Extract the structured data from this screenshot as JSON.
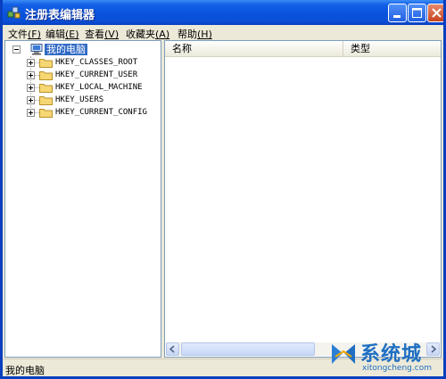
{
  "window": {
    "title": "注册表编辑器",
    "icon": "regedit-icon",
    "controls": [
      "minimize-icon",
      "maximize-icon",
      "close-icon"
    ]
  },
  "menu": [
    {
      "label": "文件",
      "accel": "(F)"
    },
    {
      "label": "编辑",
      "accel": "(E)"
    },
    {
      "label": "查看",
      "accel": "(V)"
    },
    {
      "label": "收藏夹",
      "accel": "(A)"
    },
    {
      "label": "帮助",
      "accel": "(H)"
    }
  ],
  "tree": {
    "root": "我的电脑",
    "keys": [
      "HKEY_CLASSES_ROOT",
      "HKEY_CURRENT_USER",
      "HKEY_LOCAL_MACHINE",
      "HKEY_USERS",
      "HKEY_CURRENT_CONFIG"
    ]
  },
  "list": {
    "columns": [
      "名称",
      "类型"
    ]
  },
  "statusbar": {
    "text": "我的电脑"
  },
  "watermark": {
    "brand": "系统城",
    "url": "xitongcheng.com"
  },
  "colors": {
    "titlebar": "#0a52dc",
    "selection": "#316ac5",
    "brand": "#1f6fc2"
  }
}
